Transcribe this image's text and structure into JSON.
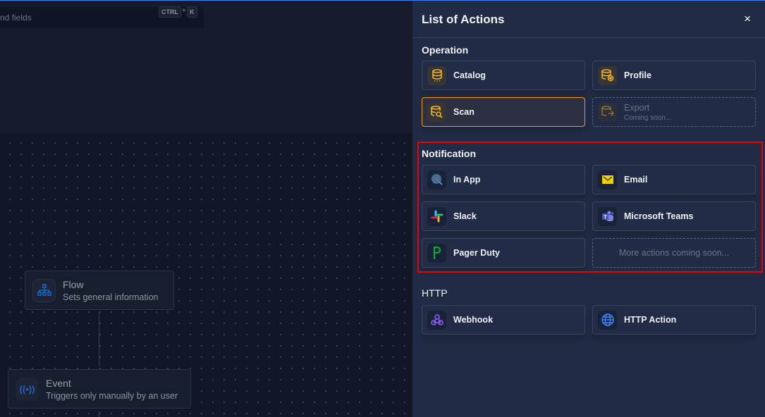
{
  "search": {
    "placeholder_text": "nd fields",
    "shortcut_ctrl": "CTRL",
    "shortcut_plus": "+",
    "shortcut_key": "K"
  },
  "canvas": {
    "nodes": [
      {
        "title": "Flow",
        "subtitle": "Sets general information",
        "icon": "sitemap-icon"
      },
      {
        "title": "Event",
        "subtitle": "Triggers only manually by an user",
        "icon": "broadcast-icon"
      }
    ]
  },
  "panel": {
    "title": "List of Actions",
    "close": "×",
    "sections": [
      {
        "title": "Operation",
        "items": [
          {
            "label": "Catalog",
            "icon": "database-icon"
          },
          {
            "label": "Profile",
            "icon": "database-eye-icon"
          },
          {
            "label": "Scan",
            "icon": "database-search-icon",
            "selected": true
          },
          {
            "label": "Export",
            "sub": "Coming soon...",
            "icon": "database-export-icon",
            "disabled": true
          }
        ]
      },
      {
        "title": "Notification",
        "items": [
          {
            "label": "In App",
            "icon": "in-app-icon"
          },
          {
            "label": "Email",
            "icon": "email-icon"
          },
          {
            "label": "Slack",
            "icon": "slack-icon"
          },
          {
            "label": "Microsoft Teams",
            "icon": "teams-icon"
          },
          {
            "label": "Pager Duty",
            "icon": "pagerduty-icon"
          },
          {
            "label": "More actions coming soon..."
          }
        ]
      },
      {
        "title": "HTTP",
        "items": [
          {
            "label": "Webhook",
            "icon": "webhook-icon"
          },
          {
            "label": "HTTP Action",
            "icon": "globe-icon"
          }
        ]
      }
    ]
  },
  "colors": {
    "accent_selected": "#f59e0b",
    "highlight": "#e00000",
    "panel_bg": "#222b45"
  }
}
